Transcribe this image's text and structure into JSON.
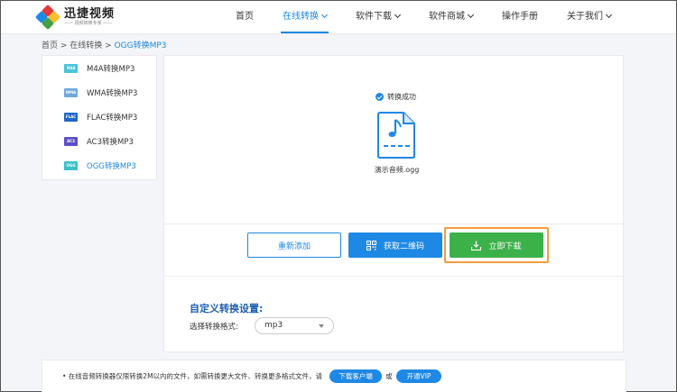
{
  "header": {
    "logo_title": "迅捷视频",
    "logo_subtitle": "—— 视频转换专家 ——",
    "nav": [
      {
        "label": "首页",
        "dropdown": false
      },
      {
        "label": "在线转换",
        "dropdown": true,
        "active": true
      },
      {
        "label": "软件下载",
        "dropdown": true
      },
      {
        "label": "软件商城",
        "dropdown": true
      },
      {
        "label": "操作手册",
        "dropdown": false
      },
      {
        "label": "关于我们",
        "dropdown": true
      }
    ]
  },
  "breadcrumb": [
    "首页",
    "在线转换",
    "OGG转换MP3"
  ],
  "sidebar": {
    "items": [
      {
        "label": "M4A转换MP3",
        "icon": "M4A",
        "color": "#4cc3d9"
      },
      {
        "label": "WMA转换MP3",
        "icon": "WMA",
        "color": "#6fa8dc"
      },
      {
        "label": "FLAC转换MP3",
        "icon": "FLAC",
        "color": "#1e66c8"
      },
      {
        "label": "AC3转换MP3",
        "icon": "AC3",
        "color": "#5b4fc7"
      },
      {
        "label": "OGG转换MP3",
        "icon": "OGG",
        "color": "#3bc1c5",
        "active": true
      }
    ]
  },
  "main": {
    "status_text": "转换成功",
    "file_name": "演示音频.ogg",
    "buttons": {
      "readd": "重新添加",
      "qrcode": "获取二维码",
      "download": "立即下载"
    },
    "settings_title": "自定义转换设置:",
    "format_label": "选择转换格式:",
    "format_value": "mp3"
  },
  "notice": {
    "text": "• 在线音频转换器仅限转换2M以内的文件，如需转换更大文件、转换更多格式文件，请",
    "client_button": "下载客户端",
    "or": "或",
    "vip_button": "开通VIP"
  },
  "colors": {
    "primary": "#1e88e5",
    "download": "#3cb14a",
    "highlight": "#f39c3d"
  }
}
